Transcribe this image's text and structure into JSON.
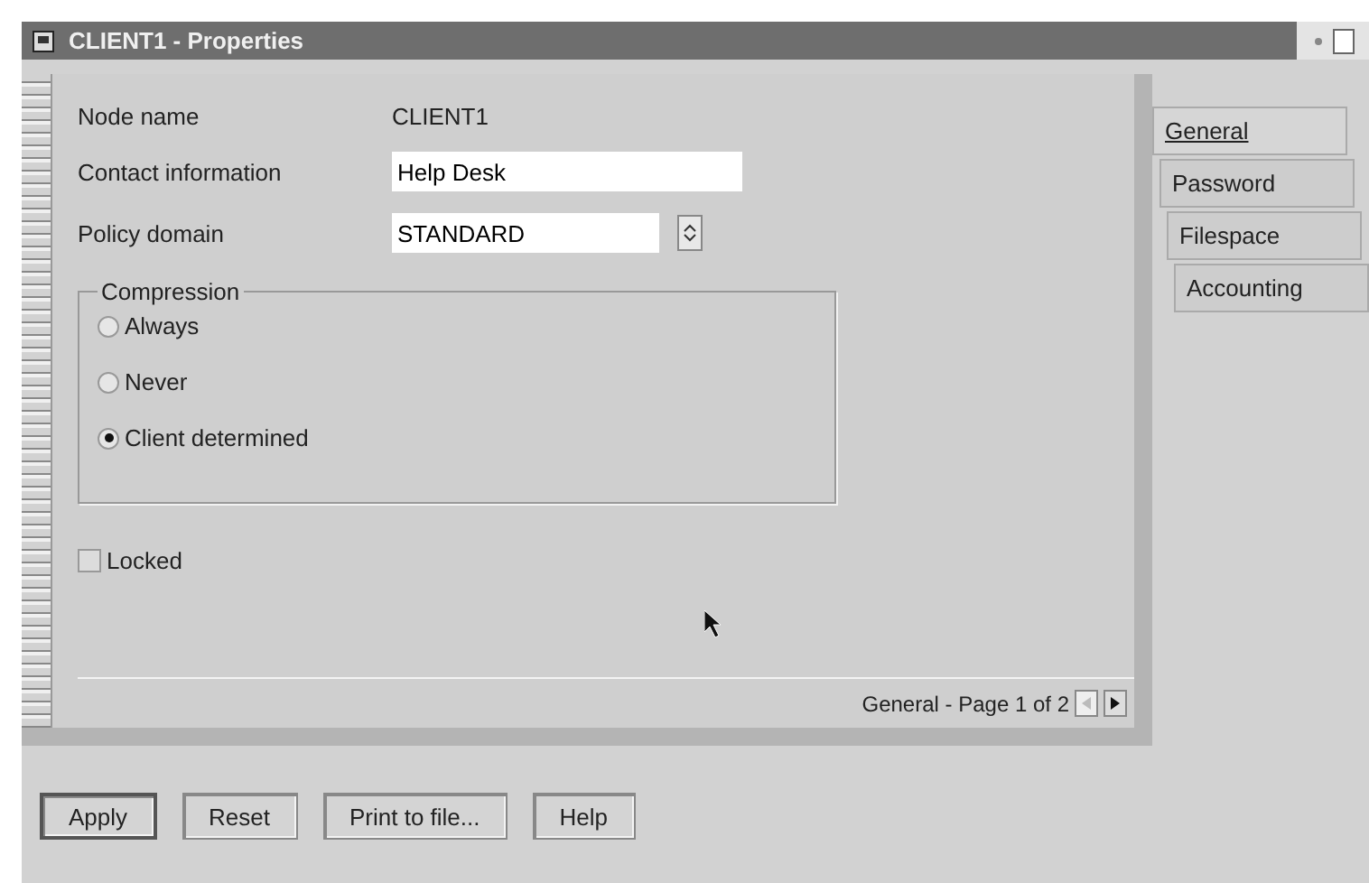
{
  "window": {
    "title": "CLIENT1 - Properties"
  },
  "fields": [
    {
      "kind": "static",
      "label": "Node name",
      "value": "CLIENT1"
    },
    {
      "kind": "entry",
      "label": "Contact information",
      "value": "Help Desk"
    },
    {
      "kind": "combo",
      "label": "Policy domain",
      "value": "STANDARD"
    }
  ],
  "compression": {
    "title": "Compression",
    "options": [
      {
        "label": "Always",
        "selected": false
      },
      {
        "label": "Never",
        "selected": false
      },
      {
        "label": "Client determined",
        "selected": true
      }
    ]
  },
  "locked": {
    "label": "Locked",
    "checked": false
  },
  "page_status": "General - Page 1 of 2",
  "page_nav": {
    "previous_disabled": true,
    "next_disabled": false
  },
  "tabs": [
    {
      "label": "General",
      "selected": true
    },
    {
      "label": "Password",
      "selected": false
    },
    {
      "label": "Filespace",
      "selected": false
    },
    {
      "label": "Accounting",
      "selected": false
    }
  ],
  "buttons": [
    {
      "label": "Apply",
      "default": true
    },
    {
      "label": "Reset",
      "default": false
    },
    {
      "label": "Print to file...",
      "default": false
    },
    {
      "label": "Help",
      "default": false
    }
  ]
}
